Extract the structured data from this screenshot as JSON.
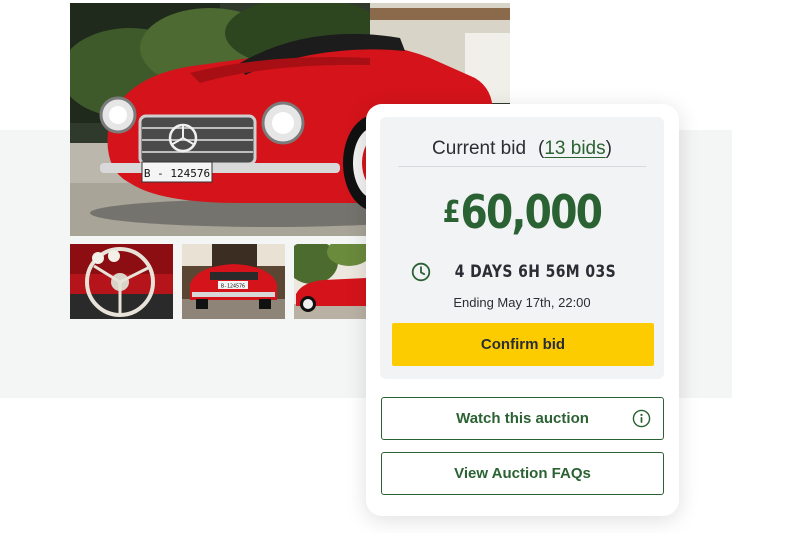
{
  "gallery": {
    "main_photo": {
      "plate": "B - 124576"
    },
    "thumbnails": [
      {
        "icon": "car-interior-thumbnail"
      },
      {
        "icon": "car-rear-thumbnail",
        "plate": "B-124576"
      },
      {
        "icon": "car-side-thumbnail"
      }
    ]
  },
  "bid": {
    "label": "Current bid",
    "paren_open": "(",
    "bids_link": "13 bids",
    "paren_close": ")",
    "currency": "£",
    "amount": "60,000",
    "countdown": "4 DAYS 6H 56M 03S",
    "countdown_icon": "clock-icon",
    "ending": "Ending May 17th, 22:00",
    "confirm_label": "Confirm bid"
  },
  "actions": {
    "watch_label": "Watch this auction",
    "watch_icon": "info-icon",
    "faq_label": "View Auction FAQs"
  },
  "colors": {
    "accent_green": "#2b6233",
    "confirm_yellow": "#fccc00",
    "car_red": "#d4141a",
    "band_grey": "#f4f5f5"
  }
}
